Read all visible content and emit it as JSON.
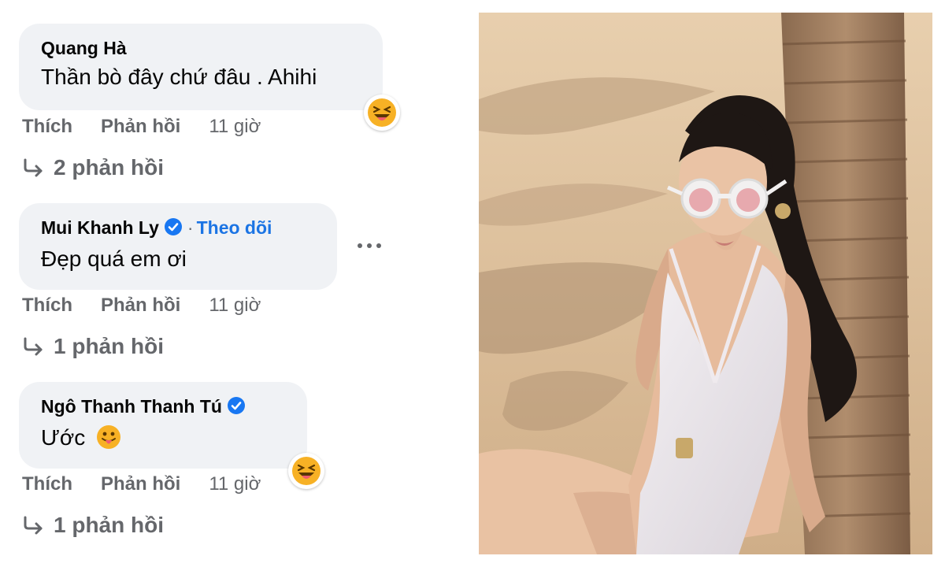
{
  "comments": [
    {
      "author": "Quang Hà",
      "text": "Thần bò đây chứ đâu . Ahihi",
      "like": "Thích",
      "reply": "Phản hồi",
      "time": "11 giờ",
      "replies": "2 phản hồi",
      "reaction": "laughing-tongue-emoji"
    },
    {
      "author": "Mui Khanh Ly",
      "verified": true,
      "follow": "Theo dõi",
      "text": "Đẹp quá em ơi",
      "like": "Thích",
      "reply": "Phản hồi",
      "time": "11 giờ",
      "replies": "1 phản hồi"
    },
    {
      "author": "Ngô Thanh Thanh Tú",
      "verified": true,
      "text": "Ước",
      "like": "Thích",
      "reply": "Phản hồi",
      "time": "11 giờ",
      "replies": "1 phản hồi",
      "reaction": "laughing-tongue-emoji"
    }
  ],
  "colors": {
    "bubble": "#f0f2f5",
    "secondary_text": "#65676b",
    "link_blue": "#1b74e4",
    "verified_blue": "#1877f2"
  },
  "photo": {
    "subject": "woman-in-white-swimsuit-on-beach-by-palm-tree-photo"
  }
}
